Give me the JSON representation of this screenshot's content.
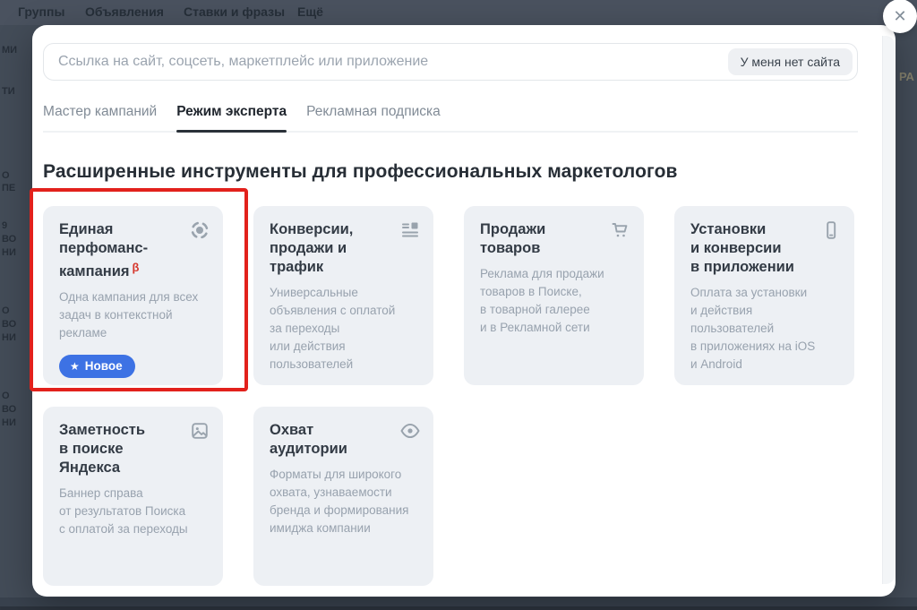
{
  "colors": {
    "badge_blue": "#3d72e4",
    "beta_red": "#d6382d",
    "highlight_red": "#e2211c"
  },
  "backdrop": {
    "top_menu": [
      "Группы",
      "Объявления",
      "Ставки и фразы",
      "Ещё"
    ],
    "left_fragments": [
      "МИ",
      "ТИ",
      "О",
      "ПЕ",
      "9",
      "ВО",
      "НИ",
      "О",
      "ВО",
      "НИ",
      "О",
      "ВО",
      "НИ"
    ],
    "right_fragment": "РА"
  },
  "modal": {
    "close_label": "✕",
    "url_input": {
      "value": "",
      "placeholder": "Ссылка на сайт, соцсеть, маркетплейс или приложение",
      "no_site_button": "У меня нет сайта"
    },
    "tabs": [
      {
        "label": "Мастер кампаний",
        "active": false
      },
      {
        "label": "Режим эксперта",
        "active": true
      },
      {
        "label": "Рекламная подписка",
        "active": false
      }
    ],
    "heading": "Расширенные инструменты для профессиональных маркетологов",
    "cards": [
      {
        "title": "Единая\nперфоманс-\nкампания",
        "beta": "β",
        "icon": "focus-icon",
        "description": "Одна кампания для всех\nзадач в контекстной\nрекламе",
        "badge": {
          "star": "★",
          "label": "Новое"
        },
        "highlighted": true
      },
      {
        "title": "Конверсии,\nпродажи и трафик",
        "icon": "text-ad-icon",
        "description": "Универсальные\nобъявления с оплатой\nза переходы\nили действия\nпользователей"
      },
      {
        "title": "Продажи товаров",
        "icon": "cart-icon",
        "description": "Реклама для продажи\nтоваров в Поиске,\nв товарной галерее\nи в Рекламной сети"
      },
      {
        "title": "Установки\nи конверсии\nв приложении",
        "icon": "smartphone-icon",
        "description": "Оплата за установки\nи действия\nпользователей\nв приложениях на iOS\nи Android"
      },
      {
        "title": "Заметность\nв поиске Яндекса",
        "icon": "image-icon",
        "description": "Баннер справа\nот результатов Поиска\nс оплатой за переходы"
      },
      {
        "title": "Охват аудитории",
        "icon": "eye-icon",
        "description": "Форматы для широкого\nохвата, узнаваемости\nбренда и формирования\nимиджа компании"
      }
    ]
  }
}
